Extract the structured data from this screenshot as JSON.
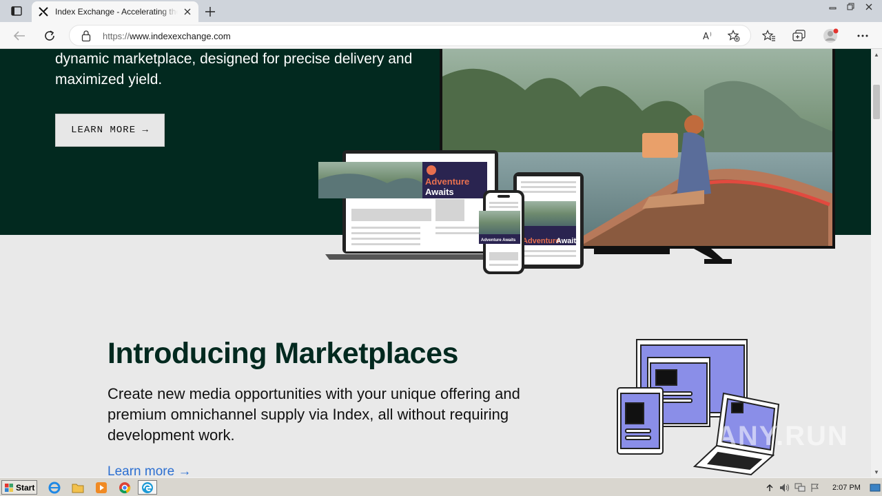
{
  "browser": {
    "tab_title": "Index Exchange - Accelerating the",
    "url_prefix": "https://",
    "url_host": "www.indexexchange.com"
  },
  "hero": {
    "text": "dynamic marketplace, designed for precise delivery and maximized yield.",
    "cta_label": "LEARN MORE →",
    "ad_banner_line1": "Adventure",
    "ad_banner_line2": "Awaits",
    "ad_small_label": "Adventure Awaits"
  },
  "intro": {
    "title": "Introducing Marketplaces",
    "body": "Create new media opportunities with your unique offering and premium omnichannel supply via Index, all without requiring development work.",
    "link_label": "Learn more →"
  },
  "watermark": "ANY.RUN",
  "taskbar": {
    "start_label": "Start",
    "clock": "2:07 PM"
  },
  "colors": {
    "hero_bg": "#02291f",
    "page_bg": "#e9e9e9",
    "link": "#2c6fd1",
    "ad_panel": "#2a2450",
    "ad_accent": "#e8704f",
    "illustration_screen": "#8a8ee8"
  }
}
